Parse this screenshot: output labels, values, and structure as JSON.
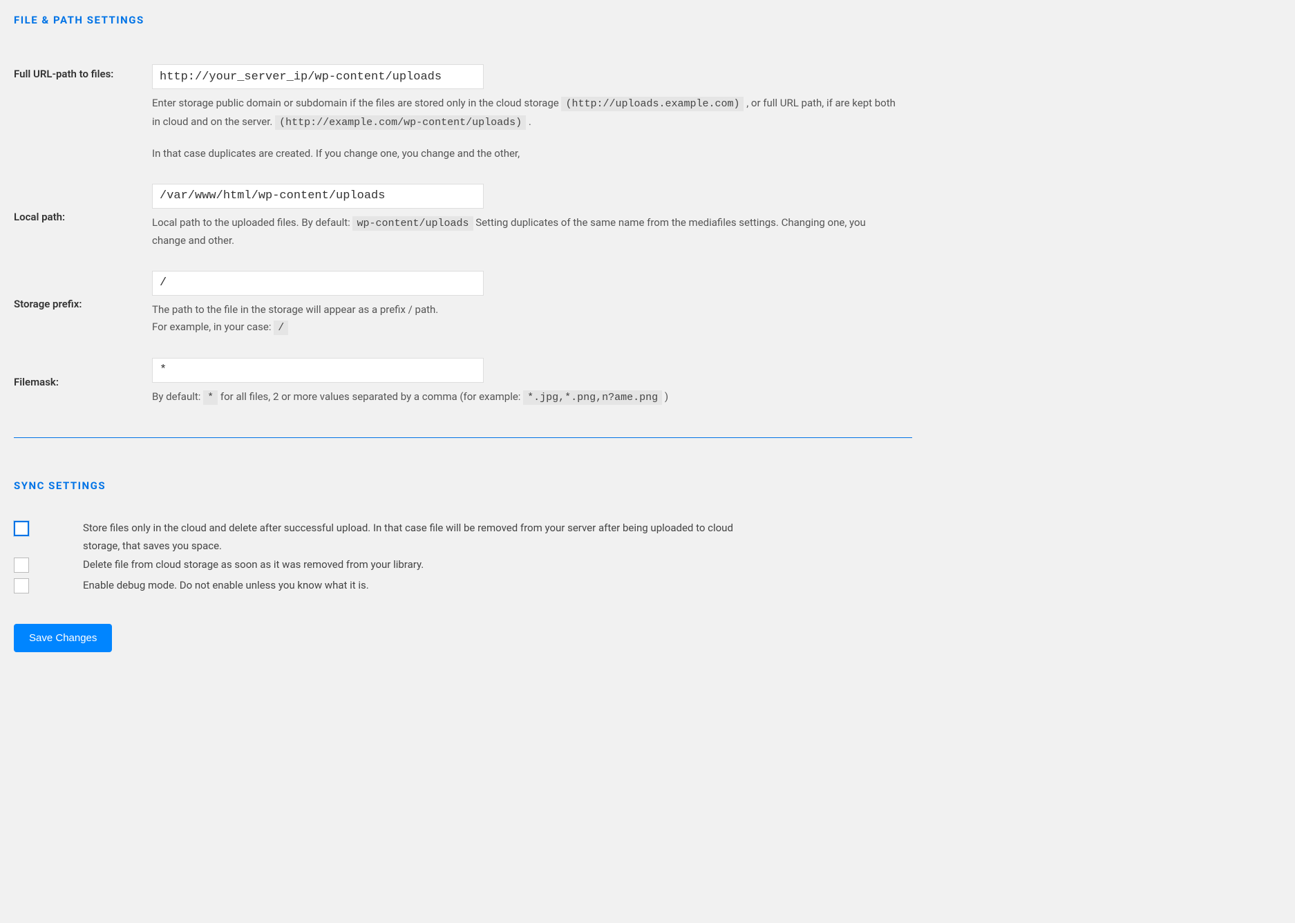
{
  "sections": {
    "file_path": {
      "heading": "FILE & PATH SETTINGS",
      "fields": {
        "full_url": {
          "label": "Full URL-path to files:",
          "value": "http://your_server_ip/wp-content/uploads",
          "desc_p1_a": "Enter storage public domain or subdomain if the files are stored only in the cloud storage ",
          "desc_p1_code1": "(http://uploads.example.com)",
          "desc_p1_b": " , or full URL path, if are kept both in cloud and on the server. ",
          "desc_p1_code2": "(http://example.com/wp-content/uploads)",
          "desc_p1_c": " .",
          "desc_p2": "In that case duplicates are created. If you change one, you change and the other,"
        },
        "local_path": {
          "label": "Local path:",
          "value": "/var/www/html/wp-content/uploads",
          "desc_a": "Local path to the uploaded files. By default: ",
          "desc_code": "wp-content/uploads",
          "desc_b": " Setting duplicates of the same name from the mediafiles settings. Changing one, you change and other."
        },
        "storage_prefix": {
          "label": "Storage prefix:",
          "value": "/",
          "desc_line1": "The path to the file in the storage will appear as a prefix / path.",
          "desc_line2_a": "For example, in your case: ",
          "desc_line2_code": "/"
        },
        "filemask": {
          "label": "Filemask:",
          "value": "*",
          "desc_a": "By default: ",
          "desc_code1": "*",
          "desc_b": " for all files, 2 or more values separated by a comma (for example: ",
          "desc_code2": "*.jpg,*.png,n?ame.png",
          "desc_c": " )"
        }
      }
    },
    "sync": {
      "heading": "SYNC SETTINGS",
      "options": [
        {
          "label": "Store files only in the cloud and delete after successful upload. In that case file will be removed from your server after being uploaded to cloud storage, that saves you space.",
          "checked": false,
          "focus": true
        },
        {
          "label": "Delete file from cloud storage as soon as it was removed from your library.",
          "checked": false,
          "focus": false
        },
        {
          "label": "Enable debug mode. Do not enable unless you know what it is.",
          "checked": false,
          "focus": false
        }
      ]
    }
  },
  "save_button": "Save Changes"
}
